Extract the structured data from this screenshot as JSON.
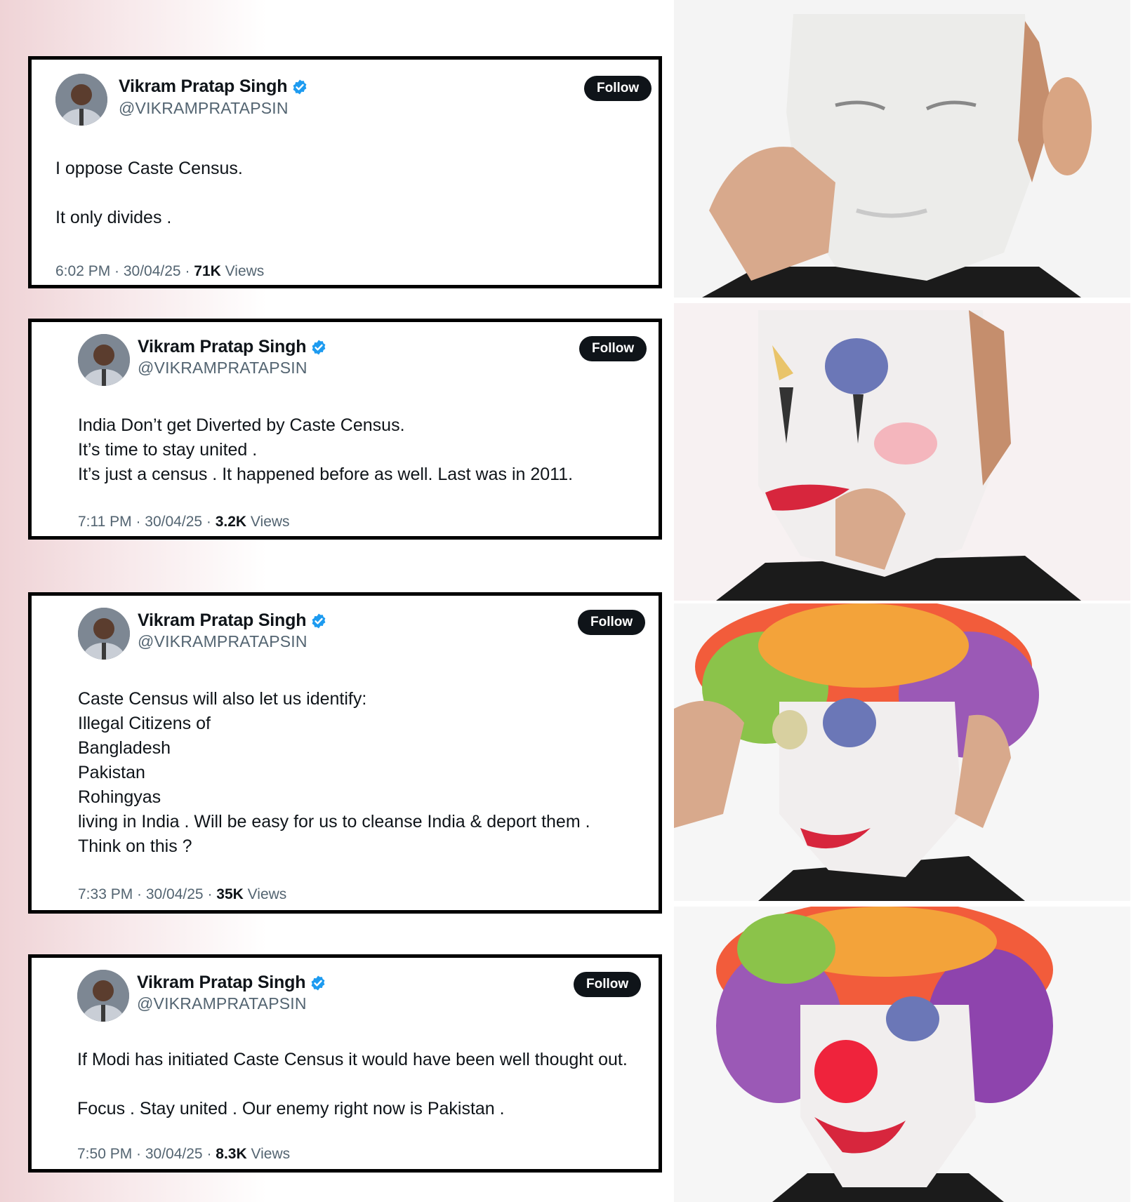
{
  "tweets": [
    {
      "name": "Vikram Pratap Singh",
      "handle": "@VIKRAMPRATAPSIN",
      "follow_label": "Follow",
      "lines": [
        "I oppose Caste Census.",
        "",
        "It only divides ."
      ],
      "time": "6:02 PM · 30/04/25 · ",
      "views_count": "71K",
      "views_label": " Views"
    },
    {
      "name": "Vikram Pratap Singh",
      "handle": "@VIKRAMPRATAPSIN",
      "follow_label": "Follow",
      "lines": [
        "India Don’t get Diverted by Caste Census.",
        "It’s time to stay united .",
        "It’s just a census . It happened before as well. Last was in 2011."
      ],
      "time": "7:11 PM · 30/04/25 · ",
      "views_count": "3.2K",
      "views_label": " Views"
    },
    {
      "name": "Vikram Pratap Singh",
      "handle": "@VIKRAMPRATAPSIN",
      "follow_label": "Follow",
      "lines": [
        "Caste Census will also let us identify:",
        "Illegal Citizens of",
        "Bangladesh",
        "Pakistan",
        "Rohingyas",
        "living in India . Will be easy for us to cleanse India & deport them .",
        "Think on this ?"
      ],
      "time": "7:33 PM · 30/04/25 · ",
      "views_count": "35K",
      "views_label": " Views"
    },
    {
      "name": "Vikram Pratap Singh",
      "handle": "@VIKRAMPRATAPSIN",
      "follow_label": "Follow",
      "lines": [
        "If Modi has initiated Caste Census it would have been well thought out.",
        "",
        "Focus . Stay united . Our enemy right now is Pakistan ."
      ],
      "time": "7:50 PM · 30/04/25 · ",
      "views_count": "8.3K",
      "views_label": " Views"
    }
  ],
  "colors": {
    "verified_blue": "#1d9bf0",
    "follow_bg": "#0f1419",
    "secondary_text": "#536471"
  },
  "icons": [
    "verified-badge-icon",
    "avatar-photo"
  ]
}
